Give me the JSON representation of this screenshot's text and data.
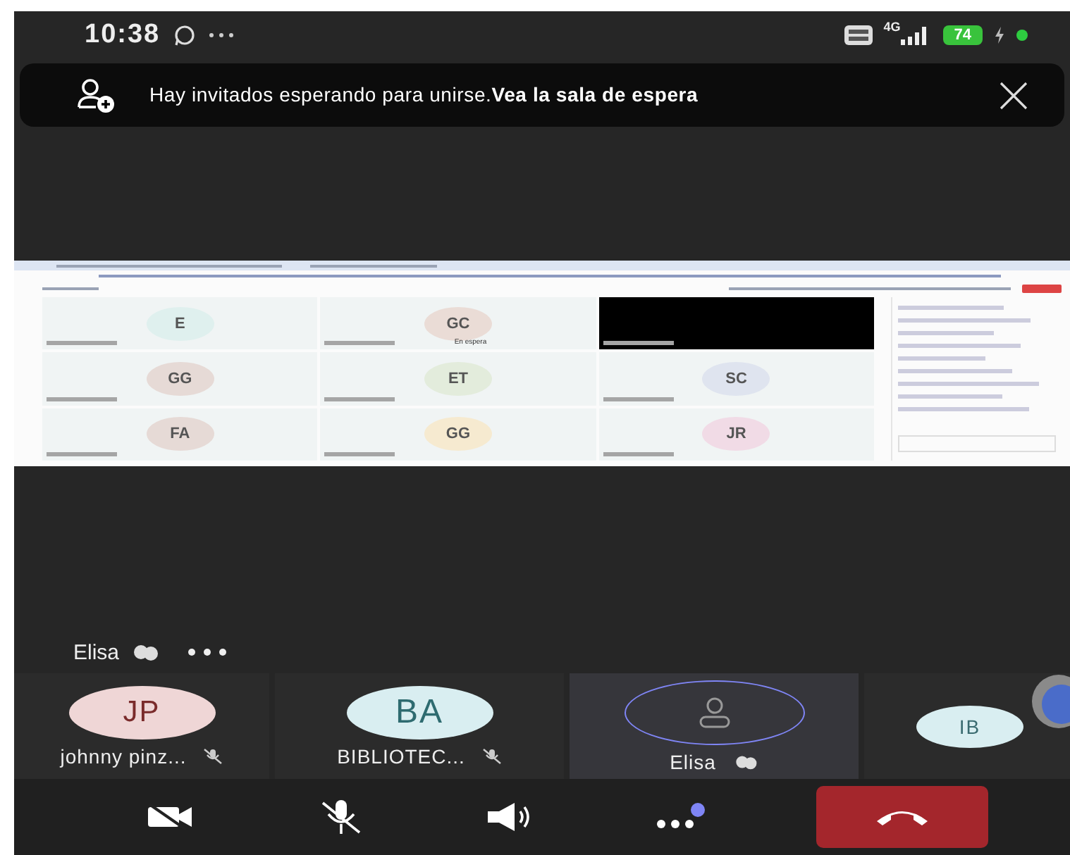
{
  "status_bar": {
    "time": "10:38",
    "network": "4G",
    "battery": "74"
  },
  "banner": {
    "text": "Hay invitados esperando para unirse.**Vea la sala de espera**"
  },
  "shared_screen": {
    "tiles": [
      {
        "kind": "avatar",
        "initials": "E",
        "color": "#dff0ee"
      },
      {
        "kind": "avatar",
        "initials": "GC",
        "color": "#eadcd6",
        "note": "En espera"
      },
      {
        "kind": "video"
      },
      {
        "kind": "avatar",
        "initials": "GG",
        "color": "#e6dad6"
      },
      {
        "kind": "avatar",
        "initials": "ET",
        "color": "#e3ecdc"
      },
      {
        "kind": "avatar",
        "initials": "SC",
        "color": "#dfe4ef"
      },
      {
        "kind": "avatar",
        "initials": "FA",
        "color": "#e6dad6"
      },
      {
        "kind": "avatar",
        "initials": "GG",
        "color": "#f6ead0"
      },
      {
        "kind": "avatar",
        "initials": "JR",
        "color": "#f1dbe6"
      }
    ]
  },
  "speaker": {
    "name": "Elisa"
  },
  "participants": [
    {
      "kind": "initials",
      "initials": "JP",
      "name": "johnny pinz...",
      "muted": true,
      "color": "#efd6d6",
      "speaking": false
    },
    {
      "kind": "initials",
      "initials": "BA",
      "name": "BIBLIOTEC...",
      "muted": true,
      "color": "#d9eef1",
      "speaking": false
    },
    {
      "kind": "self",
      "name": "Elisa",
      "muted": false,
      "speaking": true
    },
    {
      "kind": "initials",
      "initials": "IB",
      "color": "#d9eef1",
      "speaking": false
    }
  ],
  "controls": [
    {
      "kind": "camera-off"
    },
    {
      "kind": "mic-off"
    },
    {
      "kind": "speaker"
    },
    {
      "kind": "more",
      "badge": true
    },
    {
      "kind": "hangup"
    }
  ]
}
